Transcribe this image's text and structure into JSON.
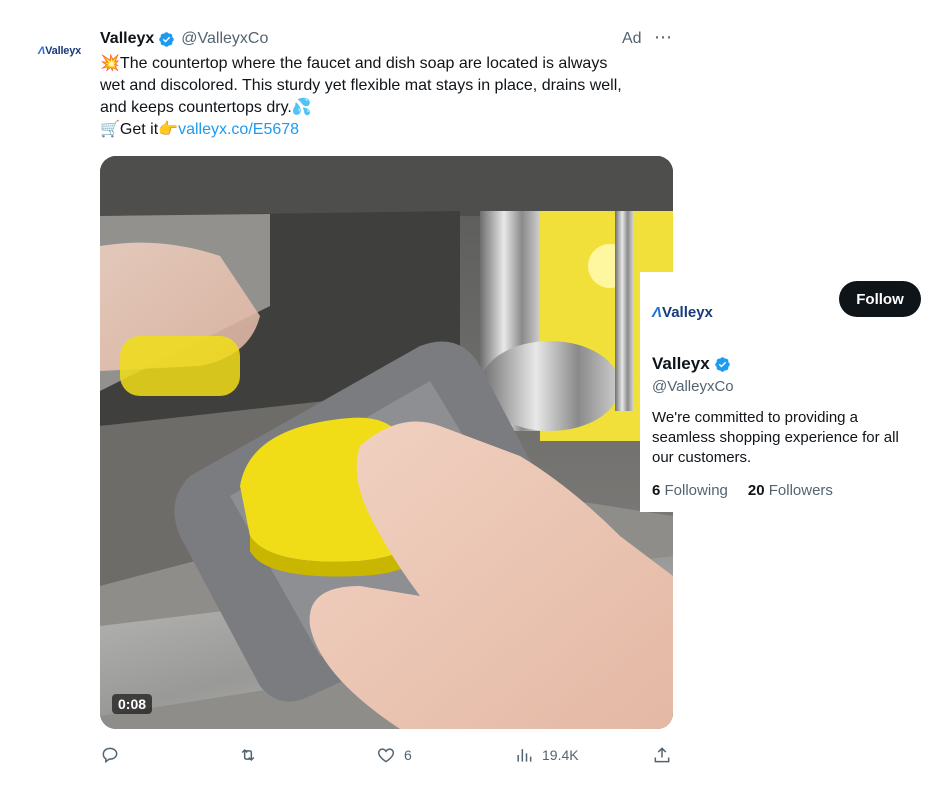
{
  "tweet": {
    "avatar_text": "Valleyx",
    "author_name": "Valleyx",
    "author_handle": "@ValleyxCo",
    "ad_label": "Ad",
    "more_icon": "more-horizontal-icon",
    "text_line1": "💥The countertop where the faucet and dish soap are located is always",
    "text_line2": "wet and discolored. This sturdy yet flexible mat stays in place, drains well,",
    "text_line3": "and keeps countertops dry.💦",
    "cta_text": "🛒Get it👉",
    "link_text": "valleyx.co/E5678",
    "video_duration": "0:08"
  },
  "actions": {
    "reply_icon": "reply-icon",
    "retweet_icon": "retweet-icon",
    "like_icon": "heart-icon",
    "like_count": "6",
    "views_icon": "views-chart-icon",
    "views_count": "19.4K",
    "share_icon": "share-icon"
  },
  "hovercard": {
    "logo_text": "Valleyx",
    "follow_label": "Follow",
    "name": "Valleyx",
    "handle": "@ValleyxCo",
    "bio": "We're committed to providing a seamless shopping experience for all our customers.",
    "following_count": "6",
    "following_label": "Following",
    "followers_count": "20",
    "followers_label": "Followers"
  },
  "colors": {
    "link": "#1d9bf0",
    "verified": "#1d9bf0",
    "follow_bg": "#0f1419"
  }
}
